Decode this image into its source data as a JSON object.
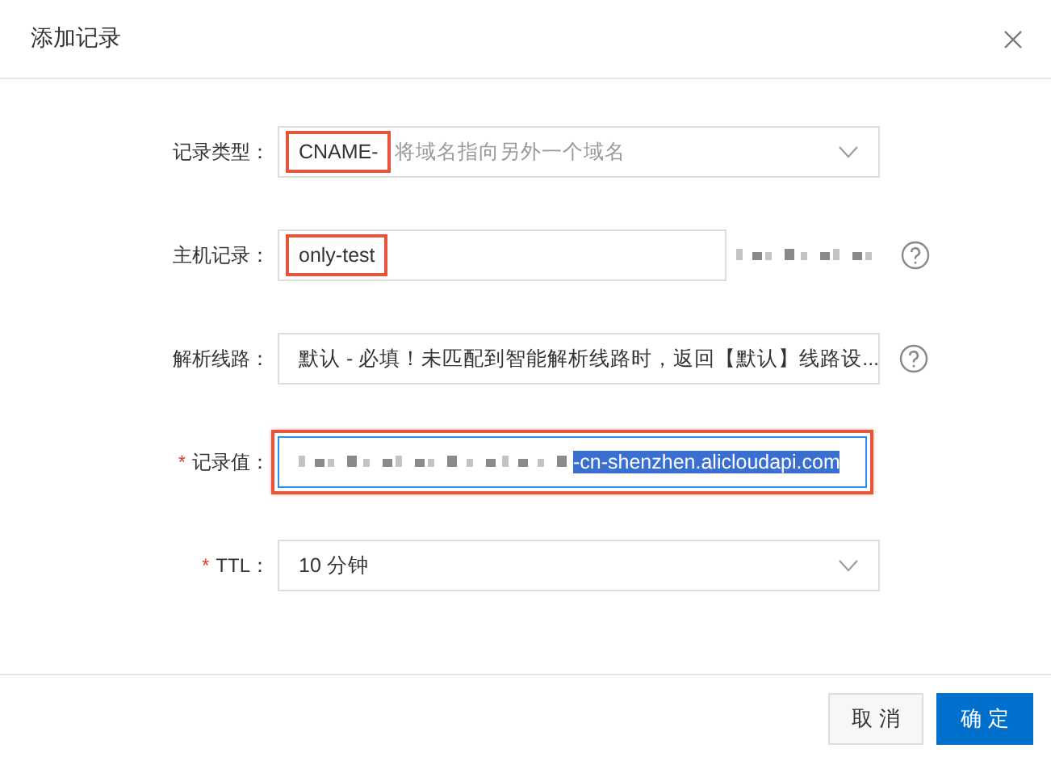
{
  "dialog": {
    "title": "添加记录"
  },
  "fields": [
    {
      "kind": "select",
      "label": "记录类型：",
      "value": "CNAME-",
      "hint": "将域名指向另外一个域名",
      "value_highlighted": true,
      "field_highlighted": false,
      "help": false,
      "focused": false
    },
    {
      "kind": "input",
      "label": "主机记录：",
      "value": "only-test",
      "value_highlighted": true,
      "field_highlighted": false,
      "help": true,
      "suffix_redacted": true,
      "focused": false
    },
    {
      "kind": "select",
      "label": "解析线路：",
      "value": "默认 - 必填！未匹配到智能解析线路时，返回【默认】线路设...",
      "value_highlighted": false,
      "field_highlighted": false,
      "help": true,
      "focused": false
    },
    {
      "kind": "input",
      "label": "记录值：",
      "required_mark": "*",
      "value": "-cn-shenzhen.alicloudapi.com",
      "value_selected": true,
      "prefix_redacted": true,
      "value_highlighted": false,
      "field_highlighted": true,
      "help": false,
      "focused": true
    },
    {
      "kind": "select",
      "label": "TTL：",
      "required_mark": "*",
      "value": "10 分钟",
      "value_highlighted": false,
      "field_highlighted": false,
      "help": false,
      "focused": false
    }
  ],
  "buttons": [
    {
      "label": "取 消",
      "primary": false
    },
    {
      "label": "确 定",
      "primary": true
    }
  ]
}
